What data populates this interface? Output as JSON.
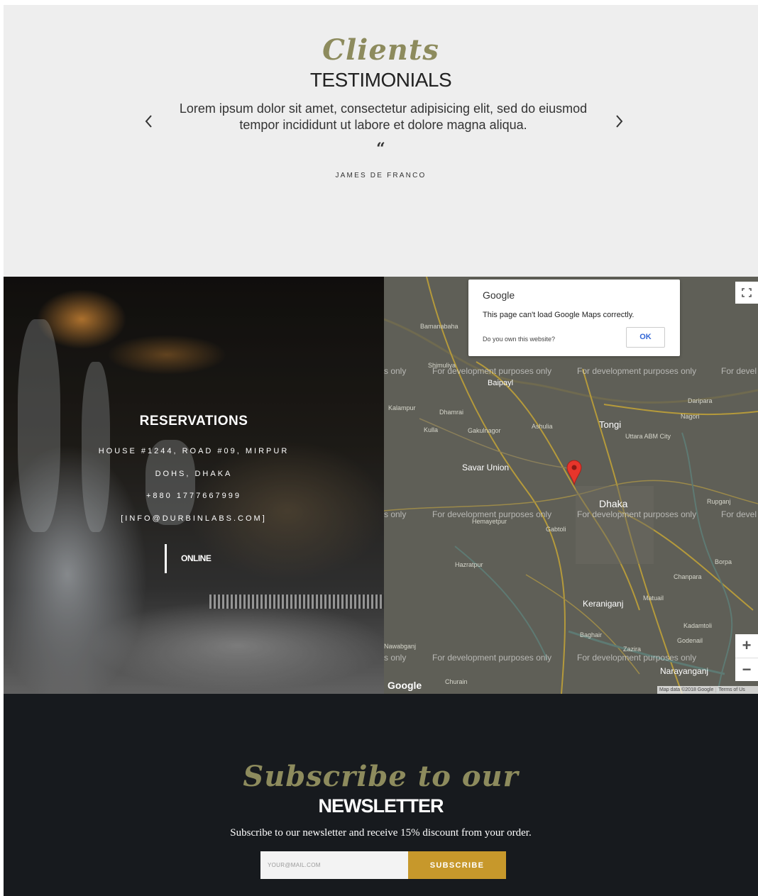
{
  "testimonials": {
    "script_title": "Clients",
    "heading": "TESTIMONIALS",
    "quote": "Lorem ipsum dolor sit amet, consectetur adipisicing elit, sed do eiusmod tempor incididunt ut labore et dolore magna aliqua.",
    "quote_mark": "“",
    "author": "JAMES DE FRANCO",
    "prev_icon": "chevron-left-icon",
    "next_icon": "chevron-right-icon"
  },
  "reservations": {
    "title": "RESERVATIONS",
    "address_line1": "HOUSE #1244, ROAD #09, MIRPUR",
    "address_line2": "DOHS, DHAKA",
    "phone": "+880 1777667999",
    "email": "[INFO@DURBINLABS.COM]",
    "online_label": "ONLINE"
  },
  "map": {
    "dialog_brand": "Google",
    "dialog_message": "This page can't load Google Maps correctly.",
    "dialog_question": "Do you own this website?",
    "ok_label": "OK",
    "watermark": "For development purposes only",
    "watermark_left": "s only",
    "watermark_right": "For devel",
    "logo": "Google",
    "credit": "Map data ©2018 Google",
    "terms": "Terms of Us",
    "zoom_in": "+",
    "zoom_out": "−",
    "cities": {
      "dhaka": "Dhaka",
      "savar": "Savar Union",
      "tongi": "Tongi",
      "keraniganj": "Keraniganj",
      "narayanganj": "Narayanganj",
      "baipayl": "Baipayl"
    },
    "towns": {
      "bamanabaha": "Bamanabaha",
      "kalampur": "Kalampur",
      "dhamrai": "Dhamrai",
      "kulla": "Kulla",
      "gakulnagor": "Gakulnagor",
      "ashulia": "Ashulia",
      "uttara": "Uttara ABM City",
      "nagori": "Nagori",
      "daripara": "Daripara",
      "hemayetpur": "Hemayetpur",
      "gabtoli": "Gabtoli",
      "hazratpur": "Hazratpur",
      "matuail": "Matuail",
      "chanpara": "Chanpara",
      "rupganj": "Rupganj",
      "borpa": "Borpa",
      "baghair": "Baghair",
      "zazira": "Zazira",
      "godenail": "Godenail",
      "kadamtoli": "Kadamtoli",
      "churain": "Churain",
      "nawabganj": "Nawabganj",
      "shimuliya": "Shimuliya"
    },
    "icons": {
      "fullscreen": "fullscreen-icon",
      "pin": "map-pin-icon"
    }
  },
  "newsletter": {
    "script_title": "Subscribe to our",
    "heading": "NEWSLETTER",
    "description": "Subscribe to our newsletter and receive 15% discount from your order.",
    "email_placeholder": "YOUR@MAIL.COM",
    "button_label": "SUBSCRIBE"
  },
  "colors": {
    "accent_olive": "#8d8b5d",
    "button_gold": "#c7982b",
    "dark_bg": "#171a1e",
    "light_bg": "#eeeeee"
  }
}
